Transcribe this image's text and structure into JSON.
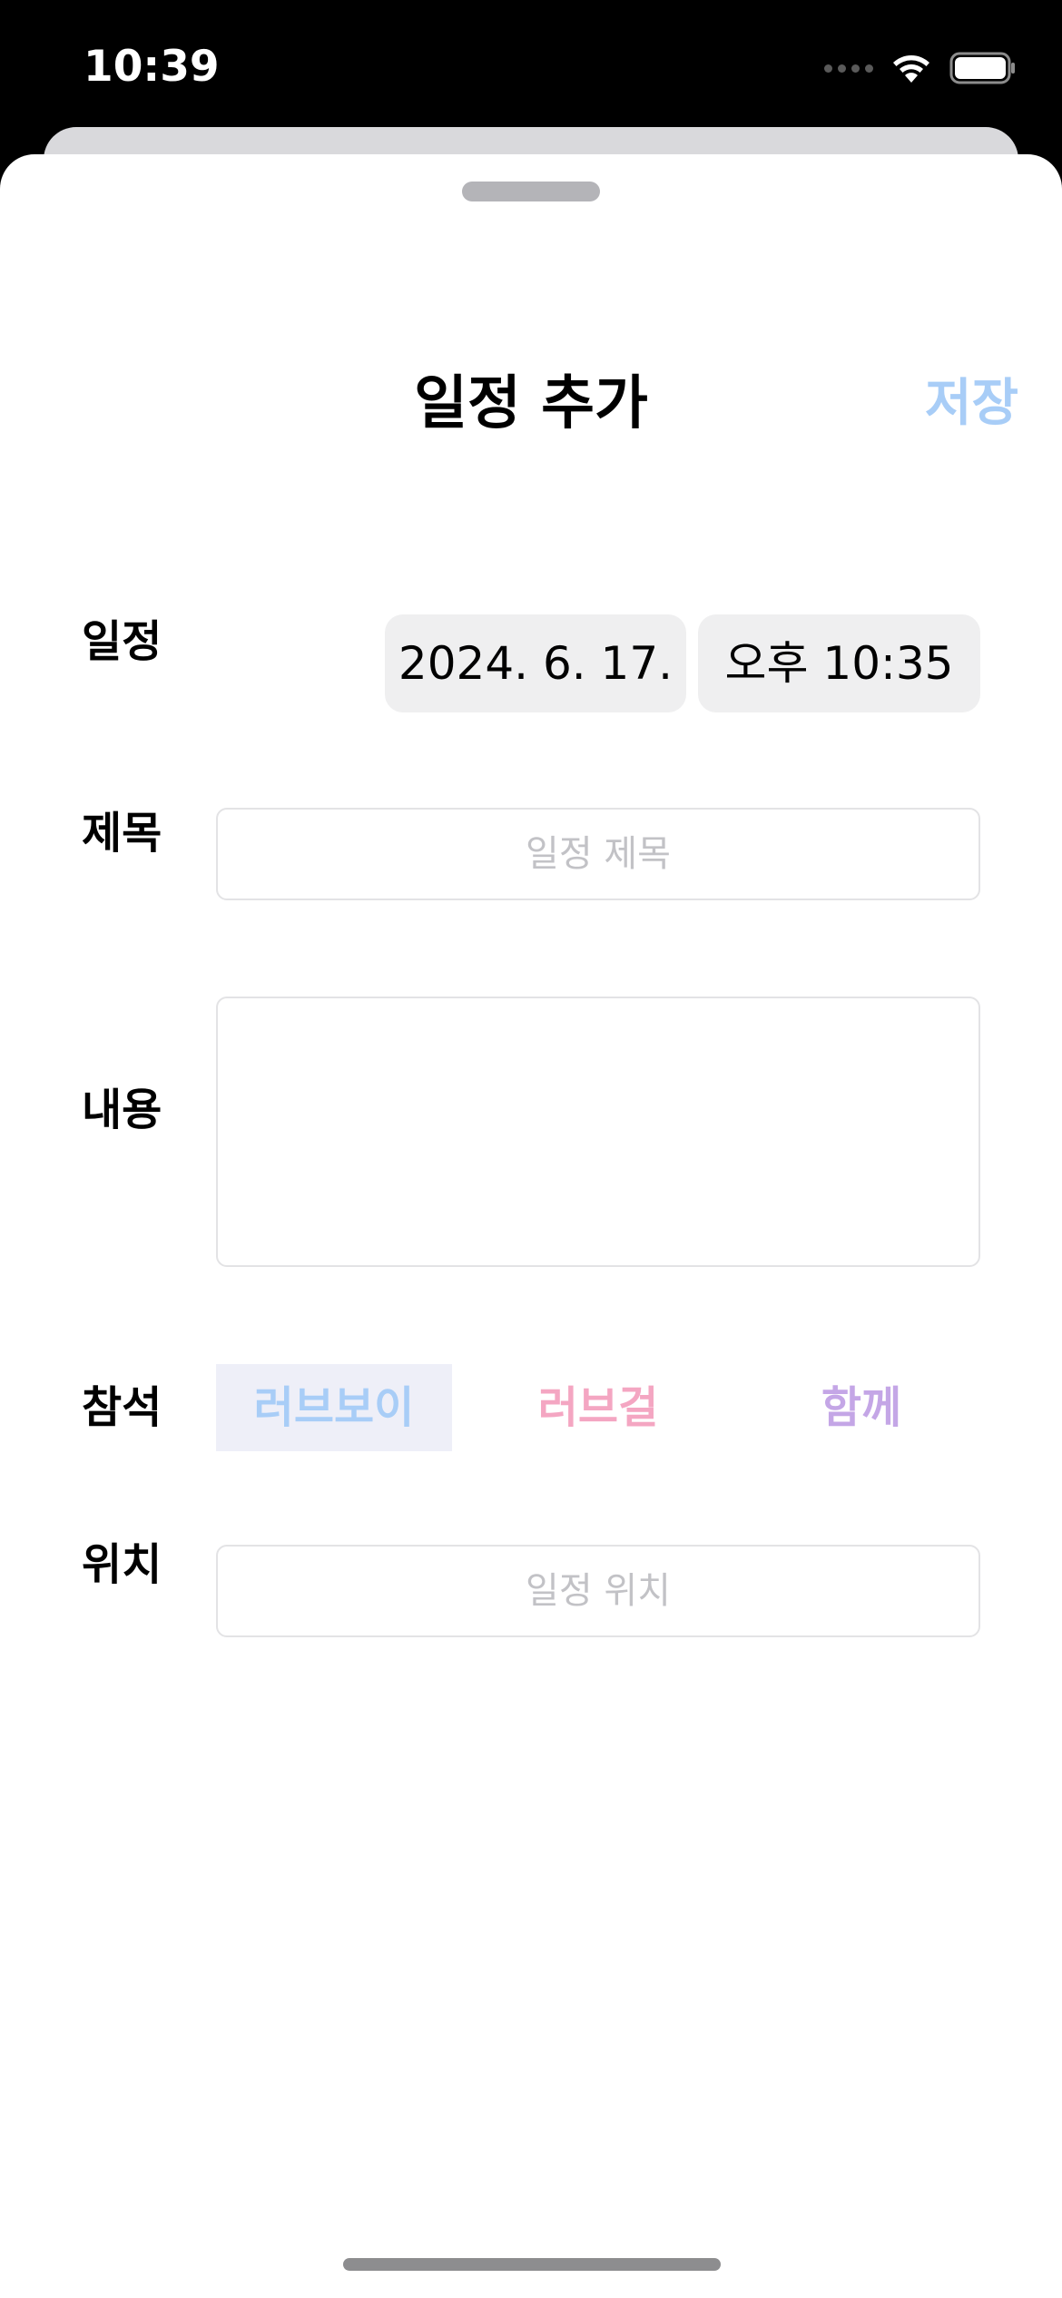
{
  "status_bar": {
    "time": "10:39",
    "icons": [
      "cellular-dots-icon",
      "wifi-icon",
      "battery-icon"
    ]
  },
  "header": {
    "title": "일정 추가",
    "save_label": "저장"
  },
  "form": {
    "schedule": {
      "label": "일정",
      "date": "2024. 6. 17.",
      "time": "오후 10:35"
    },
    "title_field": {
      "label": "제목",
      "value": "",
      "placeholder": "일정 제목"
    },
    "content_field": {
      "label": "내용",
      "value": ""
    },
    "attendance": {
      "label": "참석",
      "options": [
        {
          "label": "러브보이",
          "selected": true,
          "color": "#a8cdf7"
        },
        {
          "label": "러브걸",
          "selected": false,
          "color": "#f4a6c2"
        },
        {
          "label": "함께",
          "selected": false,
          "color": "#c4a6e6"
        }
      ]
    },
    "location_field": {
      "label": "위치",
      "value": "",
      "placeholder": "일정 위치"
    }
  },
  "colors": {
    "accent_save": "#a8cdf7",
    "pill_background": "#efeff0",
    "selected_segment_background": "#eeeff8",
    "field_border": "#e3e3e5"
  }
}
